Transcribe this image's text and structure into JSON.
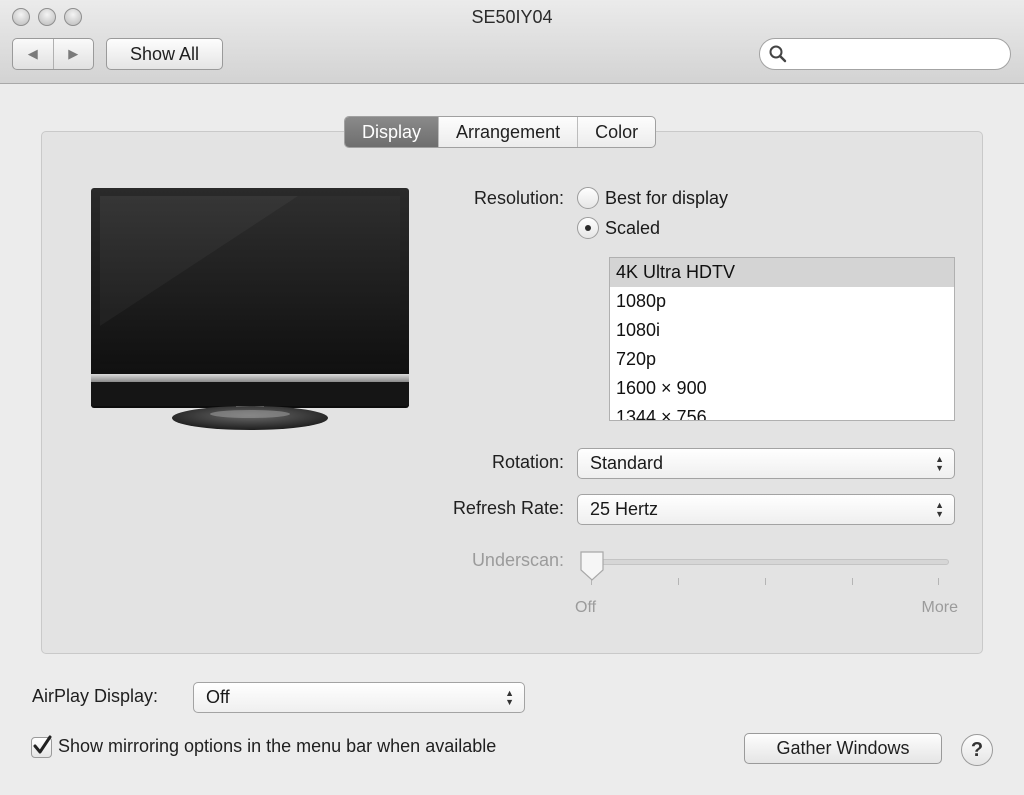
{
  "window": {
    "title": "SE50IY04"
  },
  "toolbar": {
    "back_icon": "chevron-left-icon",
    "forward_icon": "chevron-right-icon",
    "show_all_label": "Show All",
    "search": {
      "value": "",
      "placeholder": ""
    }
  },
  "tabs": [
    {
      "label": "Display",
      "active": true
    },
    {
      "label": "Arrangement",
      "active": false
    },
    {
      "label": "Color",
      "active": false
    }
  ],
  "display": {
    "resolution_label": "Resolution:",
    "resolution_options": [
      {
        "label": "Best for display",
        "selected": false
      },
      {
        "label": "Scaled",
        "selected": true
      }
    ],
    "scaled_list": [
      {
        "label": "4K Ultra HDTV",
        "selected": true
      },
      {
        "label": "1080p",
        "selected": false
      },
      {
        "label": "1080i",
        "selected": false
      },
      {
        "label": "720p",
        "selected": false
      },
      {
        "label": "1600 × 900",
        "selected": false
      },
      {
        "label": "1344 × 756",
        "selected": false
      }
    ],
    "rotation_label": "Rotation:",
    "rotation_value": "Standard",
    "refresh_label": "Refresh Rate:",
    "refresh_value": "25 Hertz",
    "underscan_label": "Underscan:",
    "underscan_min": "Off",
    "underscan_max": "More",
    "underscan_level": 0
  },
  "footer": {
    "airplay_label": "AirPlay Display:",
    "airplay_value": "Off",
    "mirroring_label": "Show mirroring options in the menu bar when available",
    "mirroring_checked": true,
    "gather_label": "Gather Windows",
    "help_label": "?"
  }
}
